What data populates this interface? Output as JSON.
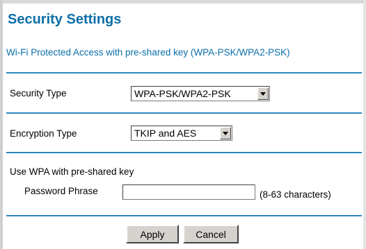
{
  "header": {
    "title": "Security Settings",
    "subtitle": "Wi-Fi Protected Access with pre-shared key (WPA-PSK/WPA2-PSK)"
  },
  "security_type": {
    "label": "Security Type",
    "selected": "WPA-PSK/WPA2-PSK"
  },
  "encryption_type": {
    "label": "Encryption Type",
    "selected": "TKIP and AES"
  },
  "wpa_key": {
    "section_label": "Use WPA with pre-shared key",
    "password_label": "Password Phrase",
    "password_value": "",
    "hint": "(8-63 characters)"
  },
  "actions": {
    "apply_label": "Apply",
    "cancel_label": "Cancel"
  },
  "colors": {
    "title": "#0b6fa8",
    "divider": "#2b86c0",
    "button_face": "#d6d3ce"
  },
  "icons": {
    "dropdown": "chevron-down-icon"
  }
}
